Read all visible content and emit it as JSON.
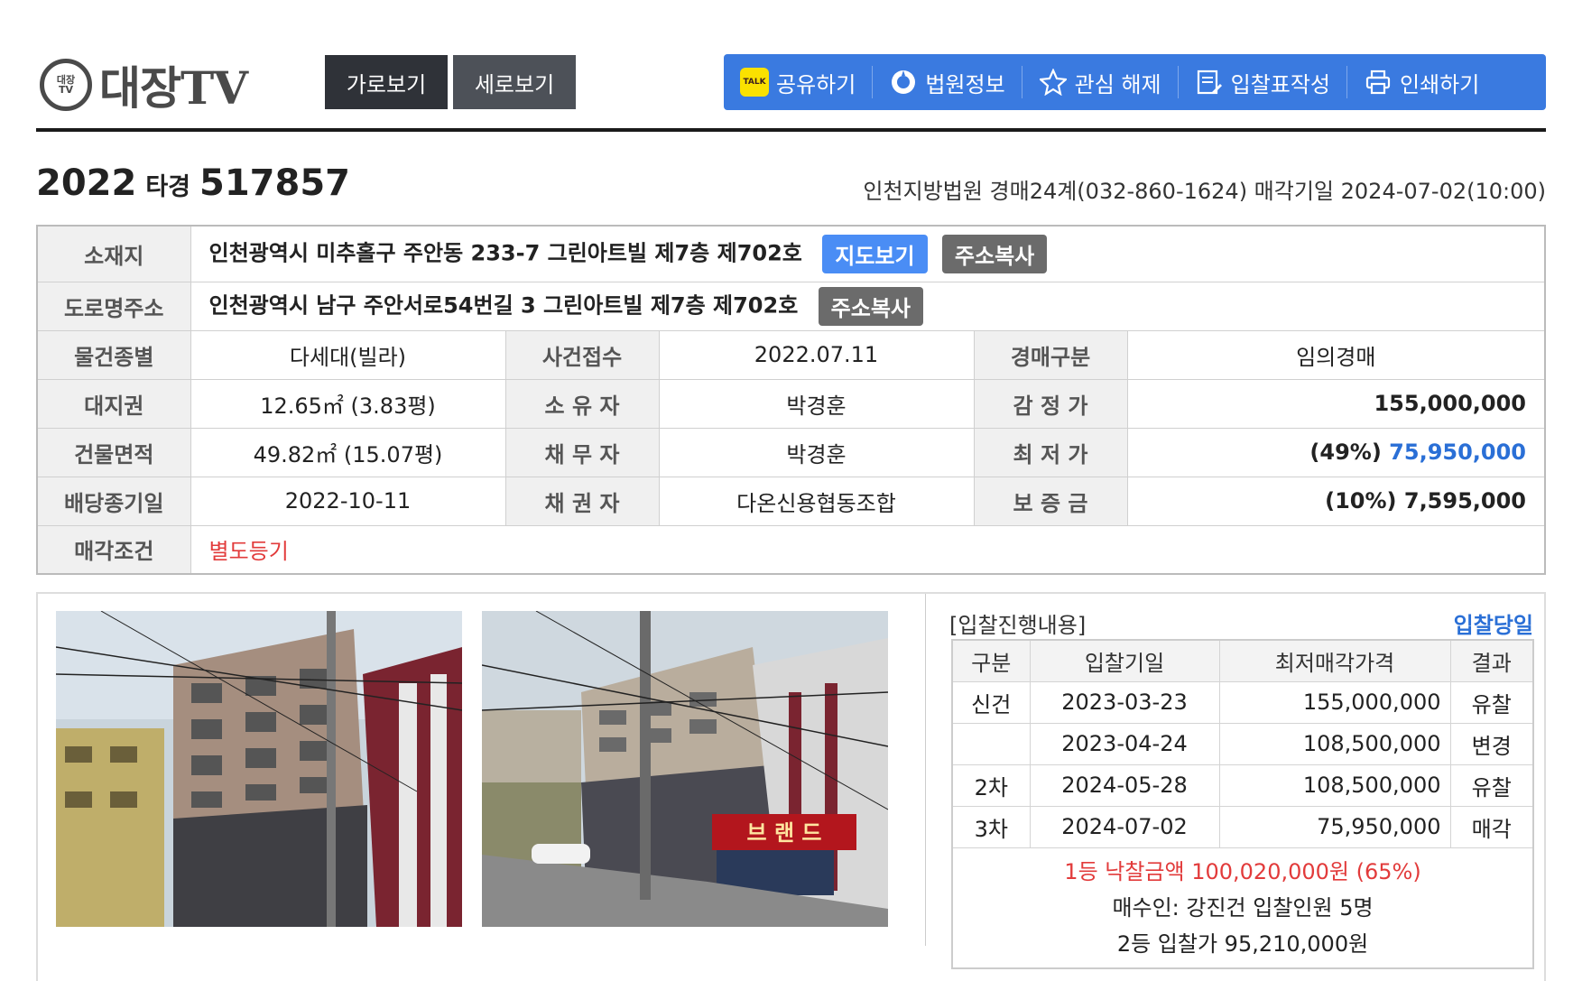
{
  "header": {
    "logo_badge_top": "대장",
    "logo_badge_bottom": "TV",
    "logo_text": "대장TV",
    "view_horizontal": "가로보기",
    "view_vertical": "세로보기",
    "toolbar": {
      "share": "공유하기",
      "court_info": "법원정보",
      "unwatch": "관심 해제",
      "bid_form": "입찰표작성",
      "print": "인쇄하기"
    }
  },
  "case": {
    "year": "2022",
    "type": "타경",
    "number": "517857",
    "court_line": "인천지방법원 경매24계(032-860-1624) 매각기일 2024-07-02(10:00)"
  },
  "info": {
    "location_label": "소재지",
    "location": "인천광역시 미추홀구 주안동 233-7 그린아트빌 제7층 제702호",
    "map_button": "지도보기",
    "copy_button": "주소복사",
    "road_label": "도로명주소",
    "road": "인천광역시 남구 주안서로54번길 3 그린아트빌 제7층 제702호",
    "rows": [
      {
        "l1": "물건종별",
        "v1": "다세대(빌라)",
        "l2": "사건접수",
        "v2": "2022.07.11",
        "l3": "경매구분",
        "v3": "임의경매"
      },
      {
        "l1": "대지권",
        "v1": "12.65㎡ (3.83평)",
        "l2": "소 유 자",
        "v2": "박경훈",
        "l3": "감 정 가",
        "v3": "155,000,000"
      },
      {
        "l1": "건물면적",
        "v1": "49.82㎡ (15.07평)",
        "l2": "채 무 자",
        "v2": "박경훈",
        "l3": "최 저 가",
        "v3_prefix": "(49%) ",
        "v3": "75,950,000"
      },
      {
        "l1": "배당종기일",
        "v1": "2022-10-11",
        "l2": "채 권 자",
        "v2": "다온신용협동조합",
        "l3": "보 증 금",
        "v3": "(10%) 7,595,000"
      }
    ],
    "sale_cond_label": "매각조건",
    "sale_cond": "별도등기"
  },
  "bid": {
    "title": "[입찰진행내용]",
    "today": "입찰당일",
    "headers": [
      "구분",
      "입찰기일",
      "최저매각가격",
      "결과"
    ],
    "rows": [
      {
        "round": "신건",
        "date": "2023-03-23",
        "price": "155,000,000",
        "result": "유찰"
      },
      {
        "round": "",
        "date": "2023-04-24",
        "price": "108,500,000",
        "result": "변경"
      },
      {
        "round": "2차",
        "date": "2024-05-28",
        "price": "108,500,000",
        "result": "유찰"
      },
      {
        "round": "3차",
        "date": "2024-07-02",
        "price": "75,950,000",
        "result": "매각"
      }
    ],
    "winning": "1등 낙찰금액 100,020,000원 (65%)",
    "buyer": "매수인: 강진건 입찰인원 5명",
    "second": "2등 입찰가 95,210,000원"
  },
  "photos": {
    "sign_text": "브 랜 드"
  },
  "colors": {
    "accent": "#3a7ae0",
    "red": "#e23b3b",
    "blue": "#2a6fd6"
  }
}
